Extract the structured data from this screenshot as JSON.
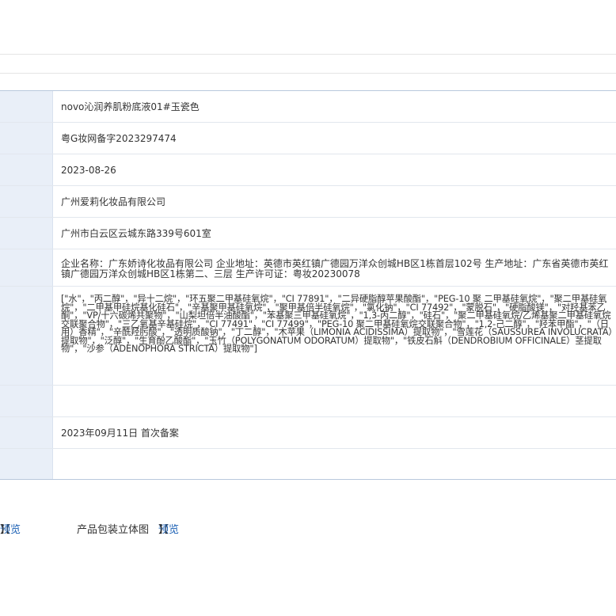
{
  "details": {
    "product_name": "novo沁润养肌粉底液01#玉瓷色",
    "registration_no": "粤G妆网备字2023297474",
    "filing_date": "2023-08-26",
    "filer": "广州爱莉化妆品有限公司",
    "filer_address": "广州市白云区云城东路339号601室",
    "manufacturer_info": "企业名称：广东娇诗化妆品有限公司 企业地址：英德市英红镇广德园万洋众创城HB区1栋首层102号 生产地址：广东省英德市英红镇广德园万洋众创城HB区1栋第二、三层 生产许可证：粤妆20230078",
    "ingredients": "[\"水\"，\"丙二醇\"，\"异十二烷\"，\"环五聚二甲基硅氧烷\"，\"CI 77891\"，\"二异硬脂醇苹果酸酯\"，\"PEG-10 聚 二甲基硅氧烷\"，\"聚二甲基硅氧烷\"，\"二甲基甲硅烷基化硅石\"，\"辛基聚甲基硅氧烷\"，\"聚甲基倍半硅氧烷\"，\"氯化钠\"，\"CI 77492\"，\"蒙脱石\"，\"硬脂酸镁\"，\"对羟基苯乙酮\"，\"VP/十六碳烯共聚物\"，\"山梨坦倍半油酸酯\"，\"苯基聚三甲基硅氧烷\"，\"1,3-丙二醇\"，\"硅石\"，\"聚二甲基硅氧烷/乙烯基聚二甲基硅氧烷交联聚合物\"，\"三乙氧基辛基硅烷\"，\"CI 77491\"，\"CI 77499\"，\"PEG-10 聚二甲基硅氧烷交联聚合物\"，\"1,2-己二醇\"，\"羟苯甲酯\"，\"（日用）香精\"，\"辛酰羟肟酸\"，\"透明质酸钠\"，\"丁二醇\"，\"木苹果（LIMONIA ACIDISSIMA）提取物\"，\"雪莲花（SAUSSUREA INVOLUCRATA）提取物\"，\"泛醇\"，\"生育酚乙酸酯\"，\"玉竹（POLYGONATUM ODORATUM）提取物\"，\"铁皮石斛（DENDROBIUM OFFICINALE）茎提取物\"，\"沙参（ADENOPHORA STRICTA）提取物\"]",
    "empty_1": "",
    "filing_status": "2023年09月11日 首次备案",
    "empty_2": ""
  },
  "footer": {
    "preview_link_1": "预览",
    "package_label": "产品包装立体图",
    "preview_link_2": "预览"
  }
}
